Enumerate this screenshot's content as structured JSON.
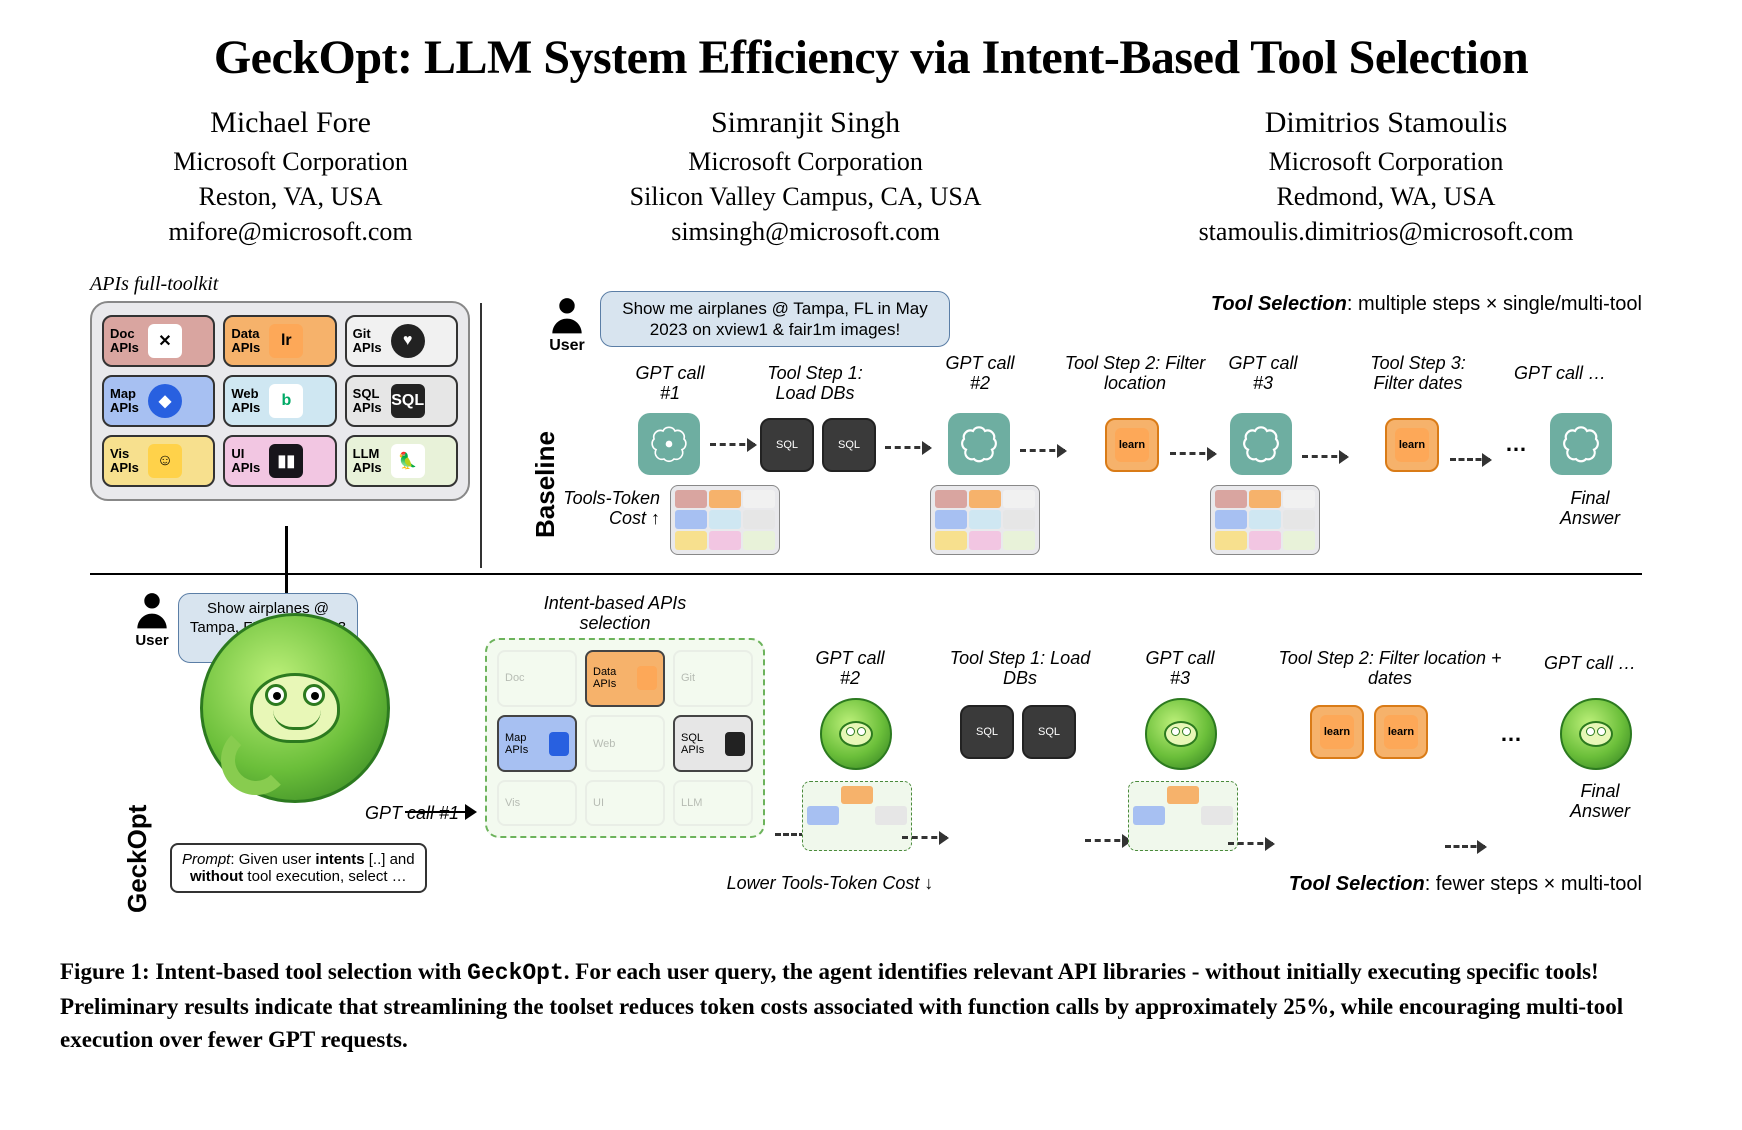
{
  "title": "GeckOpt: LLM System Efficiency via Intent-Based Tool Selection",
  "authors": [
    {
      "name": "Michael Fore",
      "affil": "Microsoft Corporation",
      "loc": "Reston, VA, USA",
      "email": "mifore@microsoft.com"
    },
    {
      "name": "Simranjit Singh",
      "affil": "Microsoft Corporation",
      "loc": "Silicon Valley Campus, CA, USA",
      "email": "simsingh@microsoft.com"
    },
    {
      "name": "Dimitrios Stamoulis",
      "affil": "Microsoft Corporation",
      "loc": "Redmond, WA, USA",
      "email": "stamoulis.dimitrios@microsoft.com"
    }
  ],
  "toolkit_label": "APIs full-toolkit",
  "apis": {
    "doc": "Doc APIs",
    "data": "Data APIs",
    "git": "Git APIs",
    "map": "Map APIs",
    "web": "Web APIs",
    "sql": "SQL APIs",
    "vis": "Vis APIs",
    "ui": "UI APIs",
    "llm": "LLM APIs"
  },
  "row_labels": {
    "baseline": "Baseline",
    "geckopt": "GeckOpt"
  },
  "user_label": "User",
  "bubble_top": "Show me airplanes @ Tampa, FL in May 2023 on xview1 & fair1m images!",
  "bubble_bottom": "Show airplanes @ Tampa, FL in May 2023 on xview1 …",
  "baseline_ts_note": "Tool Selection: multiple steps × single/multi-tool",
  "geckopt_ts_note": "Tool Selection: fewer steps × multi-tool",
  "labels": {
    "gpt1": "GPT call #1",
    "gpt2": "GPT call #2",
    "gpt3": "GPT call #3",
    "gptN": "GPT call …",
    "step1": "Tool Step 1: Load DBs",
    "step2_base": "Tool Step 2: Filter location",
    "step3_base": "Tool Step 3: Filter dates",
    "step2_geck": "Tool Step 2: Filter location + dates",
    "final": "Final Answer",
    "tokens_up": "Tools-Token Cost ↑",
    "tokens_down": "Lower Tools-Token Cost ↓",
    "intent_sel": "Intent-based APIs selection"
  },
  "prompt_box": "Prompt: Given user intents [..] and without tool execution, select …",
  "caption_pre": "Figure 1: Intent-based tool selection with ",
  "caption_code": "GeckOpt",
  "caption_post": ". For each user query, the agent identifies relevant API libraries - without initially executing specific tools! Preliminary results indicate that streamlining the toolset reduces token costs associated with function calls by approximately 25%, while encouraging multi-tool execution over fewer GPT requests.",
  "ellipsis": "…"
}
